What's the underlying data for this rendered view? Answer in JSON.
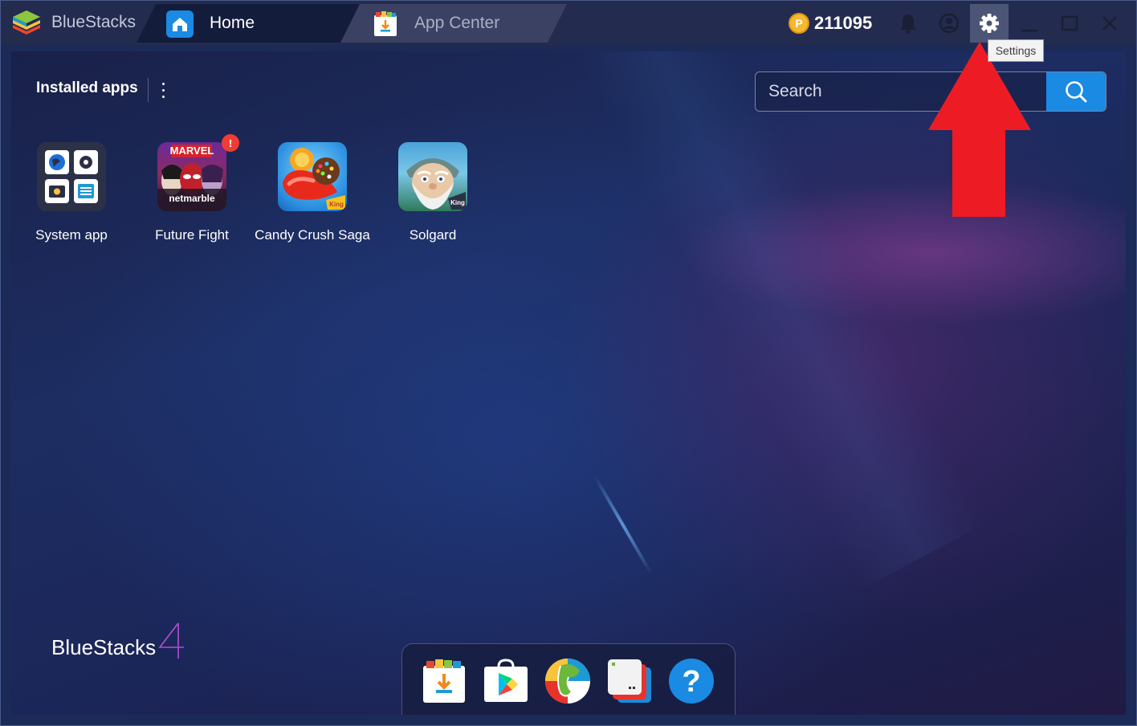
{
  "titlebar": {
    "brand": "BlueStacks",
    "tabs": [
      {
        "label": "Home",
        "active": true
      },
      {
        "label": "App Center",
        "active": false
      }
    ],
    "coins": "211095",
    "coin_symbol": "P",
    "tooltip": "Settings",
    "icons": [
      "bell-icon",
      "user-icon",
      "gear-icon",
      "minimize-icon",
      "maximize-icon",
      "close-icon"
    ]
  },
  "main": {
    "section_title": "Installed apps",
    "search": {
      "placeholder": "Search"
    },
    "apps": [
      {
        "label": "System app",
        "icon": "system-app-icon"
      },
      {
        "label": "Future Fight",
        "icon": "future-fight-icon",
        "badge": "!",
        "icon_texts": [
          "MARVEL",
          "netmarble"
        ]
      },
      {
        "label": "Candy Crush Saga",
        "icon": "candy-crush-icon",
        "icon_texts": [
          "King"
        ]
      },
      {
        "label": "Solgard",
        "icon": "solgard-icon",
        "icon_texts": [
          "King"
        ]
      }
    ],
    "watermark": "BlueStacks",
    "watermark_version": "4"
  },
  "dock": {
    "items": [
      "app-center-icon",
      "play-store-icon",
      "globe-icon",
      "multi-instance-icon",
      "help-icon"
    ],
    "help_symbol": "?"
  },
  "colors": {
    "accent": "#1a8ae3",
    "titlebar": "#232b4f",
    "arrow": "#ed1c24",
    "badge": "#ef3d36"
  }
}
